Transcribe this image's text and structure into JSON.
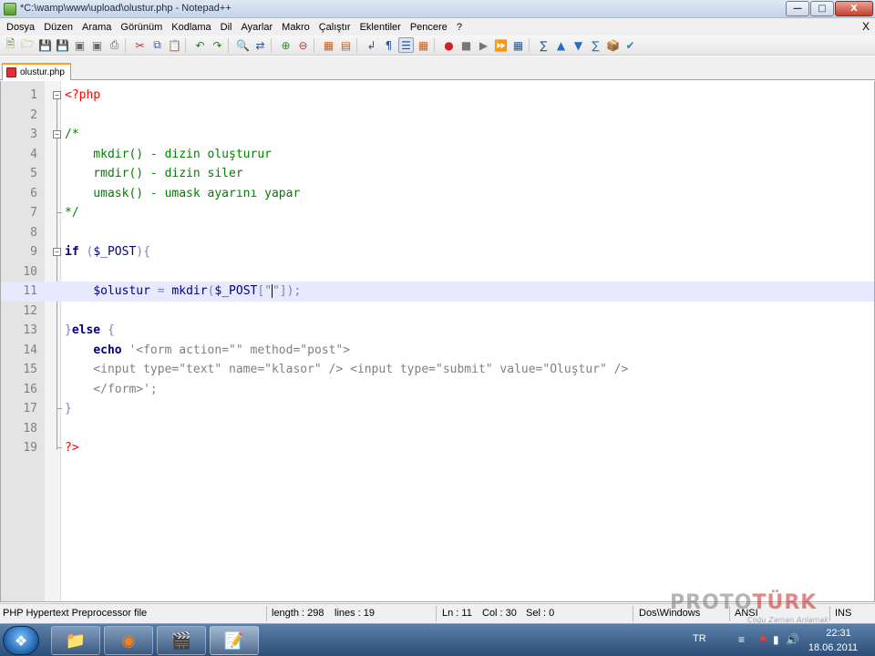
{
  "window": {
    "title": "*C:\\wamp\\www\\upload\\olustur.php - Notepad++",
    "minimize": "—",
    "maximize": "□",
    "close": "X"
  },
  "menu": {
    "items": [
      "Dosya",
      "Düzen",
      "Arama",
      "Görünüm",
      "Kodlama",
      "Dil",
      "Ayarlar",
      "Makro",
      "Çalıştır",
      "Eklentiler",
      "Pencere",
      "?"
    ],
    "close_doc": "X"
  },
  "toolbar": {
    "icons": [
      "new-file-icon",
      "open-file-icon",
      "save-icon",
      "save-all-icon",
      "close-icon",
      "close-all-icon",
      "print-icon",
      "cut-icon",
      "copy-icon",
      "paste-icon",
      "undo-icon",
      "redo-icon",
      "find-icon",
      "replace-icon",
      "zoom-in-icon",
      "zoom-out-icon",
      "sync-vertical-icon",
      "sync-horizontal-icon",
      "word-wrap-icon",
      "all-chars-icon",
      "indent-guide-icon",
      "fold-icon",
      "record-macro-icon",
      "stop-macro-icon",
      "play-macro-icon",
      "run-macro-multiple-icon",
      "save-macro-icon",
      "spell-icon",
      "up-icon",
      "down-icon",
      "bookmark-icon",
      "plugin-icon",
      "check-icon"
    ]
  },
  "tab": {
    "label": "olustur.php"
  },
  "editor": {
    "current_line": 11,
    "lines": [
      {
        "n": "1",
        "tokens": [
          [
            "php",
            "<?php"
          ]
        ]
      },
      {
        "n": "2",
        "tokens": []
      },
      {
        "n": "3",
        "tokens": [
          [
            "cm",
            "/*"
          ]
        ]
      },
      {
        "n": "4",
        "tokens": [
          [
            "cm",
            "    mkdir() - dizin oluşturur"
          ]
        ]
      },
      {
        "n": "5",
        "tokens": [
          [
            "cm",
            "    rmdir() - dizin siler"
          ]
        ]
      },
      {
        "n": "6",
        "tokens": [
          [
            "cm",
            "    umask() - umask ayarını yapar"
          ]
        ]
      },
      {
        "n": "7",
        "tokens": [
          [
            "cm",
            "*/"
          ]
        ]
      },
      {
        "n": "8",
        "tokens": []
      },
      {
        "n": "9",
        "tokens": [
          [
            "kw",
            "if"
          ],
          [
            "op",
            " ("
          ],
          [
            "var",
            "$_POST"
          ],
          [
            "op",
            "){"
          ]
        ]
      },
      {
        "n": "10",
        "tokens": []
      },
      {
        "n": "11",
        "tokens": [
          [
            "plain",
            "    "
          ],
          [
            "var",
            "$olustur"
          ],
          [
            "op",
            " = "
          ],
          [
            "fn",
            "mkdir"
          ],
          [
            "op",
            "("
          ],
          [
            "var",
            "$_POST"
          ],
          [
            "op",
            "["
          ],
          [
            "str",
            "\""
          ],
          [
            "cursor",
            ""
          ],
          [
            "str",
            "\""
          ],
          [
            "op",
            "]);"
          ]
        ]
      },
      {
        "n": "12",
        "tokens": []
      },
      {
        "n": "13",
        "tokens": [
          [
            "op",
            "}"
          ],
          [
            "kw",
            "else"
          ],
          [
            "op",
            " {"
          ]
        ]
      },
      {
        "n": "14",
        "tokens": [
          [
            "plain",
            "    "
          ],
          [
            "kw",
            "echo"
          ],
          [
            "str",
            " '<form action=\"\" method=\"post\">"
          ]
        ]
      },
      {
        "n": "15",
        "tokens": [
          [
            "str",
            "    <input type=\"text\" name=\"klasor\" /> <input type=\"submit\" value=\"Oluştur\" />"
          ]
        ]
      },
      {
        "n": "16",
        "tokens": [
          [
            "str",
            "    </form>'"
          ],
          [
            "op",
            ";"
          ]
        ]
      },
      {
        "n": "17",
        "tokens": [
          [
            "op",
            "}"
          ]
        ]
      },
      {
        "n": "18",
        "tokens": []
      },
      {
        "n": "19",
        "tokens": [
          [
            "php",
            "?>"
          ]
        ]
      }
    ]
  },
  "status": {
    "file_type": "PHP Hypertext Preprocessor file",
    "length": "length : 298",
    "lines": "lines : 19",
    "ln": "Ln : 11",
    "col": "Col : 30",
    "sel": "Sel : 0",
    "eol": "Dos\\Windows",
    "encoding": "ANSI",
    "mode": "INS"
  },
  "watermark": {
    "brand_a": "PROTO",
    "brand_b": "TÜRK",
    "tagline": "Çoğu Zaman Anlamak"
  },
  "taskbar": {
    "apps": [
      "explorer-icon",
      "firefox-icon",
      "media-icon",
      "notepadpp-icon"
    ],
    "lang": "TR",
    "time": "22:31",
    "date": "18.06.2011"
  }
}
